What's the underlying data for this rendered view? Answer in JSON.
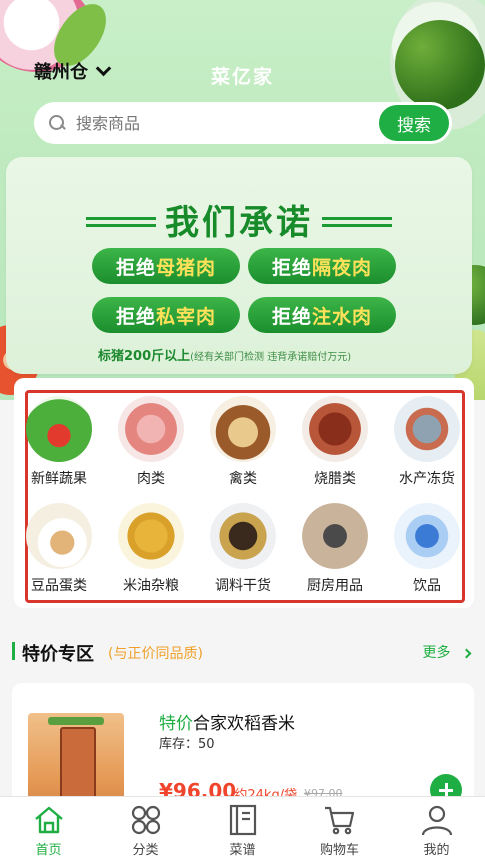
{
  "header": {
    "location": "赣州仓",
    "app_title": "菜亿家"
  },
  "search": {
    "placeholder": "搜索商品",
    "button_label": "搜索"
  },
  "banner": {
    "title": "我们承诺",
    "pills": [
      {
        "prefix": "拒绝",
        "highlight": "母猪肉"
      },
      {
        "prefix": "拒绝",
        "highlight": "隔夜肉"
      },
      {
        "prefix": "拒绝",
        "highlight": "私宰肉"
      },
      {
        "prefix": "拒绝",
        "highlight": "注水肉"
      }
    ],
    "note": "标猪200斤以上",
    "note_sub": "(经有关部门检测 违背承诺赔付万元)"
  },
  "categories": [
    {
      "label": "新鲜蔬果",
      "icon": "vegetable-icon"
    },
    {
      "label": "肉类",
      "icon": "meat-icon"
    },
    {
      "label": "禽类",
      "icon": "poultry-icon"
    },
    {
      "label": "烧腊类",
      "icon": "roast-meat-icon"
    },
    {
      "label": "水产冻货",
      "icon": "seafood-icon"
    },
    {
      "label": "豆品蛋类",
      "icon": "eggs-icon"
    },
    {
      "label": "米油杂粮",
      "icon": "rice-oil-icon"
    },
    {
      "label": "调料干货",
      "icon": "seasoning-icon"
    },
    {
      "label": "厨房用品",
      "icon": "kitchenware-icon"
    },
    {
      "label": "饮品",
      "icon": "drink-icon"
    }
  ],
  "special_zone": {
    "title": "特价专区",
    "subtitle": "(与正价同品质)",
    "more_label": "更多"
  },
  "product": {
    "tag": "特价",
    "name": "合家欢稻香米",
    "stock": "库存：50",
    "price": "¥96.00",
    "unit": "/约24kg/袋",
    "original_price": "¥97.00"
  },
  "tabbar": [
    {
      "label": "首页",
      "icon": "home-icon",
      "active": true
    },
    {
      "label": "分类",
      "icon": "category-icon",
      "active": false
    },
    {
      "label": "菜谱",
      "icon": "recipe-icon",
      "active": false
    },
    {
      "label": "购物车",
      "icon": "cart-icon",
      "active": false
    },
    {
      "label": "我的",
      "icon": "profile-icon",
      "active": false
    }
  ],
  "colors": {
    "brand_green": "#1fae43",
    "price_red": "#f0452c",
    "accent_orange": "#f0a02a",
    "highlight_box": "#d9362b"
  }
}
